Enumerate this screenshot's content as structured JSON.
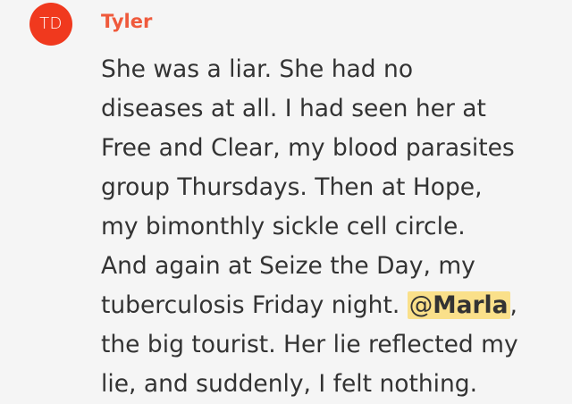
{
  "message": {
    "avatar_initials": "TD",
    "author": "Tyler",
    "lines": [
      "She was a liar. She had no",
      "diseases at all. I had seen her at",
      "Free and Clear, my blood parasites",
      "group Thursdays. Then at Hope,",
      "my bimonthly sickle cell circle.",
      "And again at Seize the Day, my"
    ],
    "line7_before_mention": "tuberculosis Friday night. ",
    "mention_at": "@",
    "mention_name": "Marla",
    "line7_after_mention": ",",
    "line8": "the big tourist. Her lie reflected my",
    "line9": "lie, and suddenly, I felt nothing."
  },
  "colors": {
    "avatar_bg": "#f0391e",
    "author": "#ef5a3c",
    "text": "#333333",
    "mention_highlight": "#fae08a",
    "background": "#f5f5f5"
  }
}
